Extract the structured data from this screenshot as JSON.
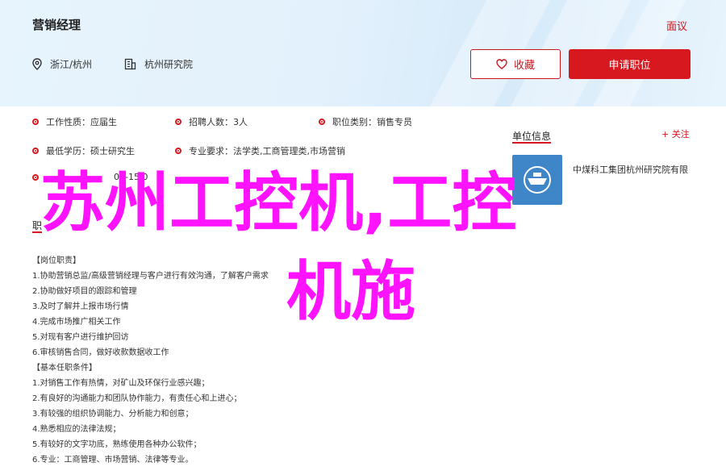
{
  "header": {
    "job_title": "营销经理",
    "report_label": "面议",
    "location": "浙江/杭州",
    "company_short": "杭州研究院",
    "favorite_label": "收藏",
    "apply_label": "申请职位"
  },
  "info": {
    "work_type_label": "工作性质：",
    "work_type_value": "应届生",
    "hire_count_label": "招聘人数：",
    "hire_count_value": "3人",
    "category_label": "职位类别：",
    "category_value": "销售专员",
    "education_label": "最低学历：",
    "education_value": "硕士研究生",
    "major_label": "专业要求：",
    "major_value": "法学类,工商管理类,市场营销",
    "date_partial": "06-15 0",
    "section_partial": "职"
  },
  "unit": {
    "title": "单位信息",
    "follow_label": "+ 关注",
    "company_name": "中煤科工集团杭州研究院有限"
  },
  "description": {
    "lines": [
      "【岗位职责】",
      "1.协助营销总监/高级营销经理与客户进行有效沟通，了解客户需求",
      "2.协助做好项目的跟踪和管理",
      "3.及时了解并上报市场行情",
      "4.完成市场推广相关工作",
      "5.对现有客户进行维护回访",
      "6.审核销售合同，做好收款数据收工作",
      "【基本任职条件】",
      "1.对销售工作有热情，对矿山及环保行业感兴趣；",
      "2.有良好的沟通能力和团队协作能力，有责任心和上进心；",
      "3.有较强的组织协调能力、分析能力和创意；",
      "4.熟悉相应的法律法规；",
      "5.有较好的文字功底，熟练使用各种办公软件；",
      "6.专业：工商管理、市场营销、法律等专业。"
    ]
  },
  "overlay": {
    "line1": "苏州工控机,工控",
    "line2": "机施"
  },
  "colors": {
    "accent": "#d7181f",
    "overlay": "#ff13ff",
    "header_bg": "#e3f1fc",
    "logo_bg": "#3f86c9"
  }
}
